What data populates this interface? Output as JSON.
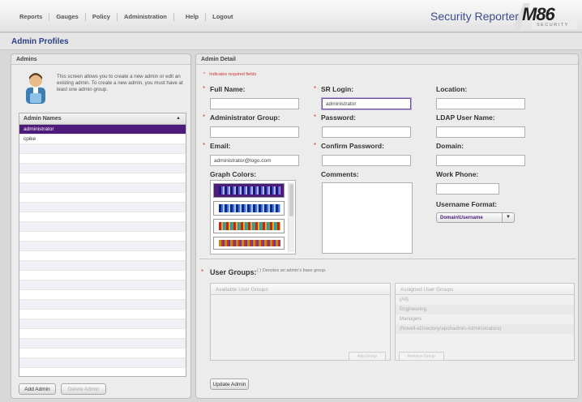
{
  "nav": {
    "items": [
      "Reports",
      "Gauges",
      "Policy",
      "Administration",
      "Help",
      "Logout"
    ],
    "brand": "Security Reporter",
    "logo": "M86",
    "logo_sub": "SECURITY"
  },
  "page": {
    "title": "Admin Profiles"
  },
  "admins_panel": {
    "heading": "Admins",
    "intro": "This screen allows you to create a new admin or edit an existing admin. To create a new admin, you must have at least one admin group.",
    "list_header": "Admin Names",
    "names": [
      "administrator",
      "cpike"
    ],
    "buttons": {
      "add": "Add Admin",
      "delete": "Delete Admin"
    }
  },
  "detail_panel": {
    "heading": "Admin Detail",
    "required_note": "Indicates required fields",
    "labels": {
      "full_name": "Full Name:",
      "sr_login": "SR Login:",
      "location": "Location:",
      "admin_group": "Administrator Group:",
      "password": "Password:",
      "ldap_user": "LDAP User Name:",
      "email": "Email:",
      "confirm_password": "Confirm Password:",
      "domain": "Domain:",
      "graph_colors": "Graph Colors:",
      "comments": "Comments:",
      "work_phone": "Work Phone:",
      "username_format": "Username Format:"
    },
    "values": {
      "full_name": "",
      "sr_login": "administrator",
      "location": "",
      "admin_group": "",
      "password": "",
      "ldap_user": "",
      "email": "administrator@logo.com",
      "confirm_password": "",
      "domain": "",
      "work_phone": "",
      "username_format": "Domain\\Username"
    },
    "user_groups": {
      "label": "User Groups:",
      "note": "( ) Denotes an admin's base group.",
      "available_header": "Available User Groups",
      "assigned_header": "Assigned User Groups",
      "assigned": [
        "(All)",
        "Engineering",
        "Managers",
        "(Novell-eDirectory/apohadmin-Administrators)"
      ],
      "add_button": "Add Group",
      "remove_button": "Remove Group"
    },
    "update_button": "Update Admin"
  },
  "colors": {
    "accent": "#4d1b7b",
    "brand": "#3c4e8e",
    "title": "#2a3f8a",
    "required": "#d32f22"
  }
}
